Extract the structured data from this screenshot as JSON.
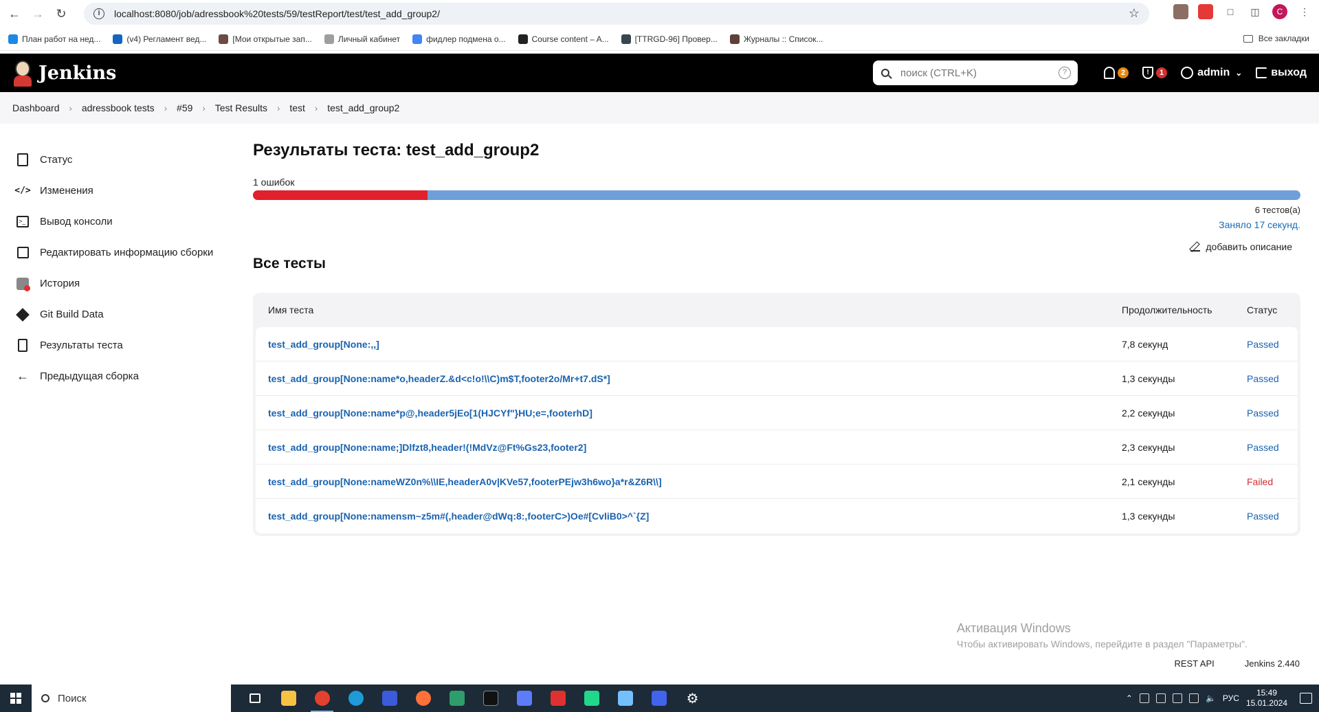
{
  "browser": {
    "url": "localhost:8080/job/adressbook%20tests/59/testReport/test/test_add_group2/",
    "profile_initial": "C",
    "bookmarks": [
      {
        "label": "План работ на нед...",
        "color": "#1e88e5"
      },
      {
        "label": "(v4) Регламент вед...",
        "color": "#1565c0"
      },
      {
        "label": "[Мои открытые зап...",
        "color": "#6d4c41"
      },
      {
        "label": "Личный кабинет",
        "color": "#9e9e9e"
      },
      {
        "label": "фидлер подмена о...",
        "color": "#4285f4"
      },
      {
        "label": "Course content – A...",
        "color": "#222222"
      },
      {
        "label": "[TTRGD-96] Провер...",
        "color": "#37474f"
      },
      {
        "label": "Журналы :: Список...",
        "color": "#5d4037"
      }
    ],
    "all_bookmarks_label": "Все закладки"
  },
  "header": {
    "brand": "Jenkins",
    "search_placeholder": "поиск (CTRL+K)",
    "notifications_count": "2",
    "security_count": "1",
    "user": "admin",
    "logout": "выход"
  },
  "breadcrumbs": [
    "Dashboard",
    "adressbook tests",
    "#59",
    "Test Results",
    "test",
    "test_add_group2"
  ],
  "sidebar": {
    "items": [
      {
        "label": "Статус",
        "icon": "document-icon"
      },
      {
        "label": "Изменения",
        "icon": "code-icon"
      },
      {
        "label": "Вывод консоли",
        "icon": "terminal-icon"
      },
      {
        "label": "Редактировать информацию сборки",
        "icon": "edit-icon"
      },
      {
        "label": "История",
        "icon": "history-icon"
      },
      {
        "label": "Git Build Data",
        "icon": "git-icon"
      },
      {
        "label": "Результаты теста",
        "icon": "clipboard-icon"
      },
      {
        "label": "Предыдущая сборка",
        "icon": "arrow-left-icon"
      }
    ]
  },
  "main": {
    "title": "Результаты теста: test_add_group2",
    "failures_label": "1 ошибок",
    "fail_fraction": 0.1667,
    "tests_count": "6 тестов(а)",
    "took": "Заняло 17 секунд.",
    "add_description": "добавить описание",
    "section_title": "Все тесты",
    "table": {
      "headers": {
        "name": "Имя теста",
        "duration": "Продолжительность",
        "status": "Статус"
      },
      "rows": [
        {
          "name": "test_add_group[None:,,]",
          "duration": "7,8 секунд",
          "status": "Passed"
        },
        {
          "name": "test_add_group[None:name*o,headerZ.&d<c!o!\\\\C)m$T,footer2o/Mr+t7.dS*]",
          "duration": "1,3 секунды",
          "status": "Passed"
        },
        {
          "name": "test_add_group[None:name*p@,header5jEo[1(HJCYf\"}HU;e=,footerhD]",
          "duration": "2,2 секунды",
          "status": "Passed"
        },
        {
          "name": "test_add_group[None:name;]Dlfzt8,header!(!MdVz@Ft%Gs23,footer2]",
          "duration": "2,3 секунды",
          "status": "Passed"
        },
        {
          "name": "test_add_group[None:nameWZ0n%\\\\IE,headerA0v|KVe57,footerPEjw3h6wo}a*r&Z6R\\\\]",
          "duration": "2,1 секунды",
          "status": "Failed"
        },
        {
          "name": "test_add_group[None:namensm~z5m#(,header@dWq:8:,footerC>)Oe#[CvliB0>^`{Z]",
          "duration": "1,3 секунды",
          "status": "Passed"
        }
      ]
    }
  },
  "watermark": {
    "line1": "Активация Windows",
    "line2": "Чтобы активировать Windows, перейдите в раздел \"Параметры\"."
  },
  "footer": {
    "rest_api": "REST API",
    "version": "Jenkins 2.440"
  },
  "taskbar": {
    "search_label": "Поиск",
    "language": "РУС",
    "time": "15:49",
    "date": "15.01.2024"
  },
  "colors": {
    "failed": "#e0202c",
    "passed_bar": "#6f9fd8",
    "link": "#1a63b0",
    "header_bg": "#000000"
  }
}
